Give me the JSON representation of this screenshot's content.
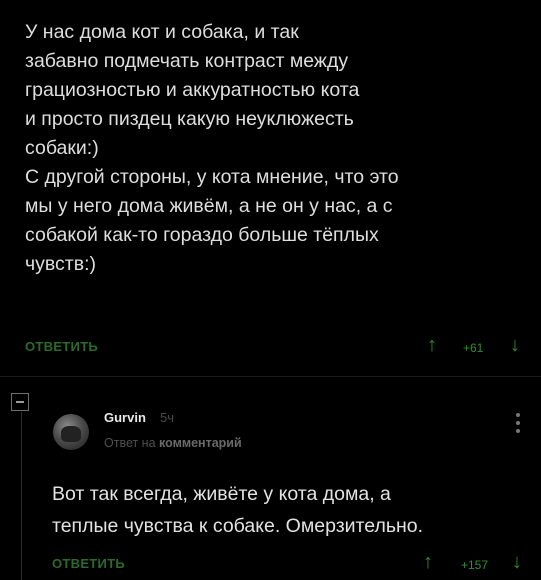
{
  "comment1": {
    "text": "У нас дома кот и собака, и так\nзабавно подмечать контраст между\nграциозностью и аккуратностью кота\nи просто пиздец какую неуклюжесть\nсобаки:)\nС другой стороны, у кота мнение, что это\nмы у него дома живём, а не он у нас, а с\nсобакой как-то гораздо больше тёплых\nчувств:)",
    "reply_label": "ОТВЕТИТЬ",
    "rating": "+61"
  },
  "comment2": {
    "username": "Gurvin",
    "time": "5ч",
    "reply_to_prefix": "Ответ на",
    "reply_to_target": "комментарий",
    "text": "Вот так всегда, живёте у кота дома, а\nтеплые чувства к собаке. Омерзительно.",
    "reply_label": "ОТВЕТИТЬ",
    "rating": "+157"
  },
  "icons": {
    "upvote": "arrow-up",
    "downvote": "arrow-down",
    "collapse": "minus-box",
    "more": "vertical-dots"
  },
  "colors": {
    "background": "#000000",
    "accent_green": "#2f8f2f",
    "text": "#dedede"
  }
}
